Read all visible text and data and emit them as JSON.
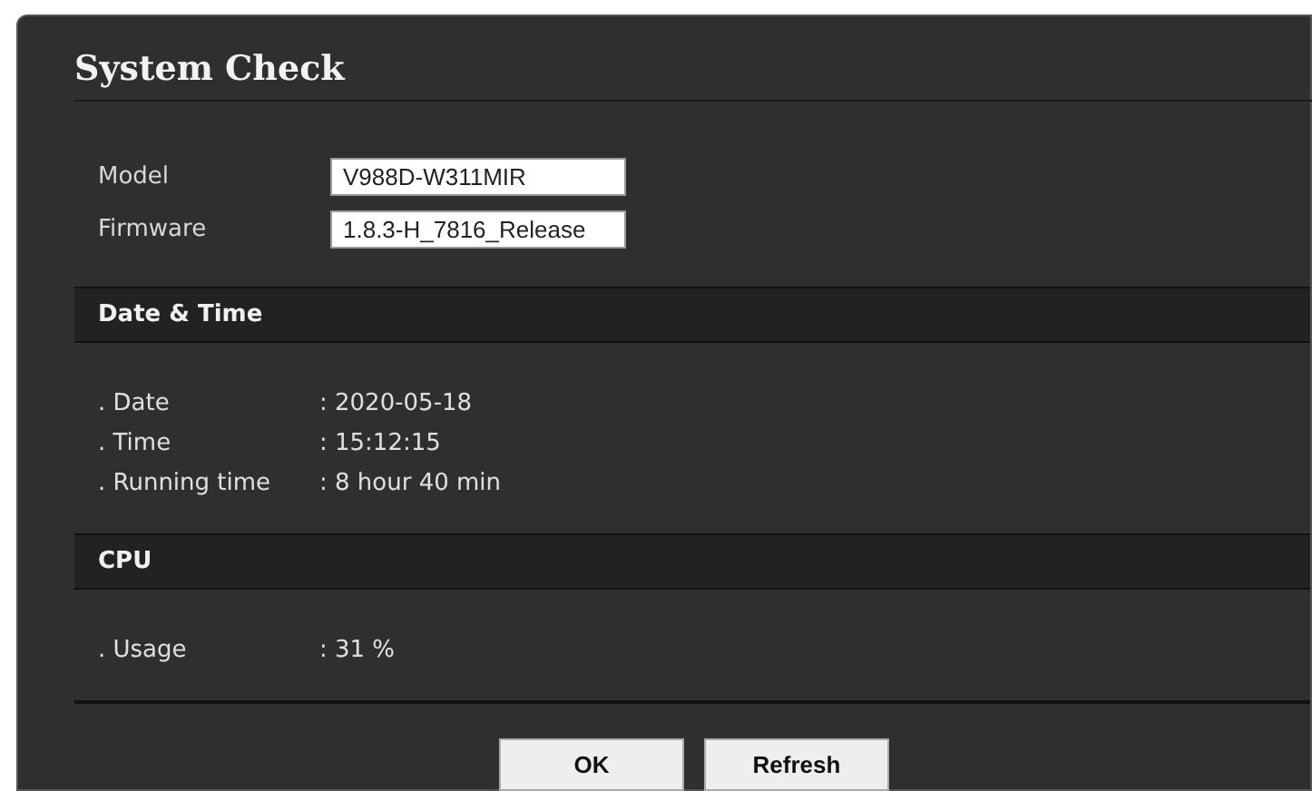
{
  "title": "System Check",
  "fields": [
    {
      "label": "Model",
      "value": "V988D-W311MIR"
    },
    {
      "label": "Firmware",
      "value": "1.8.3-H_7816_Release"
    }
  ],
  "sections": [
    {
      "title": "Date & Time",
      "rows": [
        {
          "label": ". Date",
          "value": ": 2020-05-18"
        },
        {
          "label": ". Time",
          "value": ": 15:12:15"
        },
        {
          "label": ". Running time",
          "value": ": 8 hour 40 min"
        }
      ]
    },
    {
      "title": "CPU",
      "rows": [
        {
          "label": ". Usage",
          "value": ": 31 %"
        }
      ]
    }
  ],
  "buttons": [
    "OK",
    "Refresh"
  ]
}
